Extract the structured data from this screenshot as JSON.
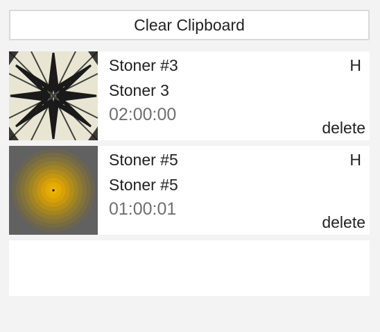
{
  "toolbar": {
    "clear_label": "Clear Clipboard"
  },
  "items": [
    {
      "title": "Stoner #3",
      "subtitle": "Stoner 3",
      "duration": "02:00:00",
      "flag": "H",
      "delete_label": "delete",
      "thumbnail": "zigzag-starburst-pattern"
    },
    {
      "title": "Stoner #5",
      "subtitle": "Stoner #5",
      "duration": "01:00:01",
      "flag": "H",
      "delete_label": "delete",
      "thumbnail": "concentric-yellow-circles"
    }
  ],
  "colors": {
    "background": "#f3f3f3",
    "card": "#ffffff",
    "duration_text": "#6f6f6f",
    "thumb2_bg": "#616161",
    "thumb2_center": "#e8b400"
  }
}
